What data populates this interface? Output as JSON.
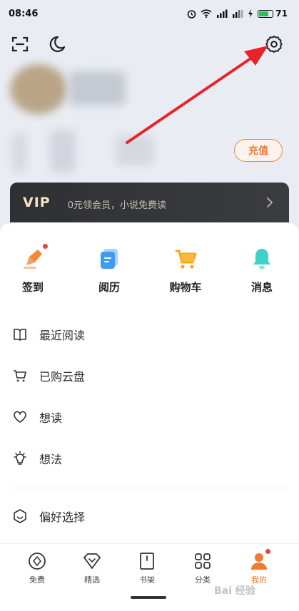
{
  "status_bar": {
    "time": "08:46",
    "battery_level": "71",
    "icons": [
      "alarm-icon",
      "wifi-icon",
      "signal-icon",
      "hd-signal-icon",
      "charging-icon",
      "battery-icon"
    ]
  },
  "header": {
    "icons": [
      "scan-icon",
      "moon-icon",
      "gear-icon"
    ],
    "recharge_label": "充值"
  },
  "vip": {
    "label": "VIP",
    "text": "0元领会员，小说免费读"
  },
  "quick_actions": [
    {
      "label": "签到",
      "icon": "sign-in-icon",
      "badge": true
    },
    {
      "label": "阅历",
      "icon": "history-icon",
      "badge": false
    },
    {
      "label": "购物车",
      "icon": "cart-icon",
      "badge": false
    },
    {
      "label": "消息",
      "icon": "bell-icon",
      "badge": false
    }
  ],
  "menu": [
    {
      "label": "最近阅读",
      "icon": "book-icon"
    },
    {
      "label": "已购云盘",
      "icon": "cart-outline-icon"
    },
    {
      "label": "想读",
      "icon": "heart-icon"
    },
    {
      "label": "想法",
      "icon": "bulb-icon"
    },
    {
      "label": "偏好选择",
      "icon": "preference-icon"
    }
  ],
  "bottom_nav": [
    {
      "label": "免费",
      "icon": "free-icon",
      "active": false
    },
    {
      "label": "精选",
      "icon": "diamond-icon",
      "active": false
    },
    {
      "label": "书架",
      "icon": "bookshelf-icon",
      "active": false
    },
    {
      "label": "分类",
      "icon": "category-icon",
      "active": false
    },
    {
      "label": "我的",
      "icon": "profile-icon",
      "active": true
    }
  ],
  "watermark": "Bai 经验",
  "colors": {
    "accent": "#f07a2e",
    "annotation_arrow": "#e8232b",
    "vip_bg": "#333437",
    "page_bg": "#e9edf3"
  }
}
